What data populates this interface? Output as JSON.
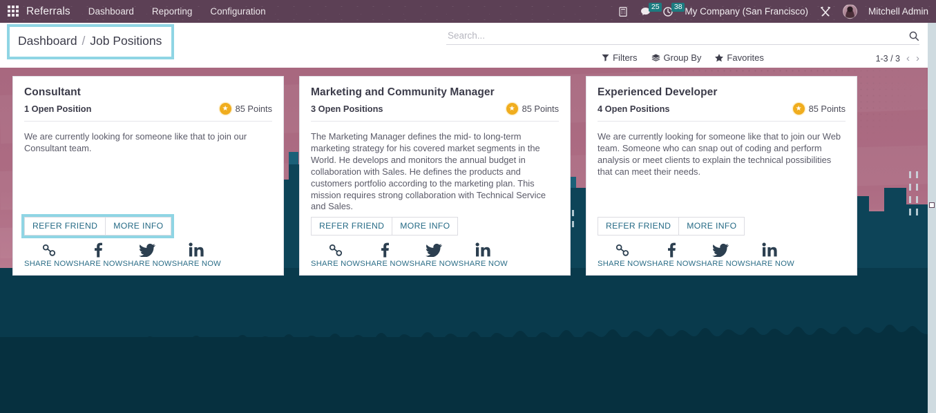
{
  "navbar": {
    "apps_icon": "apps-grid-icon",
    "brand": "Referrals",
    "menu": [
      {
        "label": "Dashboard"
      },
      {
        "label": "Reporting"
      },
      {
        "label": "Configuration"
      }
    ],
    "voip_icon": "phone-icon",
    "messages_icon": "chat-bubble-icon",
    "messages_count": "25",
    "activities_icon": "clock-icon",
    "activities_count": "38",
    "company": "My Company (San Francisco)",
    "debug_icon": "tools-icon",
    "avatar_icon": "user-avatar",
    "user": "Mitchell Admin",
    "accent_color": "#5c4055",
    "badge_color": "#1d7b80"
  },
  "controlpanel": {
    "breadcrumb_root": "Dashboard",
    "breadcrumb_separator": "/",
    "breadcrumb_current": "Job Positions",
    "highlight_color": "#8fd5e4",
    "search": {
      "placeholder": "Search...",
      "value": "",
      "icon": "search-icon"
    },
    "filters": [
      {
        "label": "Filters",
        "icon": "filter-icon"
      },
      {
        "label": "Group By",
        "icon": "layers-icon"
      },
      {
        "label": "Favorites",
        "icon": "star-icon"
      }
    ],
    "pager": {
      "range": "1-3 / 3",
      "prev_icon": "chevron-left-icon",
      "next_icon": "chevron-right-icon"
    }
  },
  "share_labels": {
    "link": "SHARE NOW",
    "facebook": "SHARE NOW",
    "twitter": "SHARE NOW",
    "linkedin": "SHARE NOW"
  },
  "buttons": {
    "refer_friend": "REFER FRIEND",
    "more_info": "MORE INFO"
  },
  "cards": [
    {
      "title": "Consultant",
      "open_positions": "1 Open Position",
      "points": "85 Points",
      "description": "We are currently looking for someone like that to join our Consultant team.",
      "highlighted": true
    },
    {
      "title": "Marketing and Community Manager",
      "open_positions": "3 Open Positions",
      "points": "85 Points",
      "description": "The Marketing Manager defines the mid- to long-term marketing strategy for his covered market segments in the World. He develops and monitors the annual budget in collaboration with Sales. He defines the products and customers portfolio according to the marketing plan. This mission requires strong collaboration with Technical Service and Sales.",
      "highlighted": false
    },
    {
      "title": "Experienced Developer",
      "open_positions": "4 Open Positions",
      "points": "85 Points",
      "description": "We are currently looking for someone like that to join our Web team. Someone who can snap out of coding and perform analysis or meet clients to explain the technical possibilities that can meet their needs.",
      "highlighted": false
    }
  ],
  "background": {
    "sky_color": "#ad6c83",
    "city_color": "#0d4458",
    "ground_color": "#093a4c"
  }
}
